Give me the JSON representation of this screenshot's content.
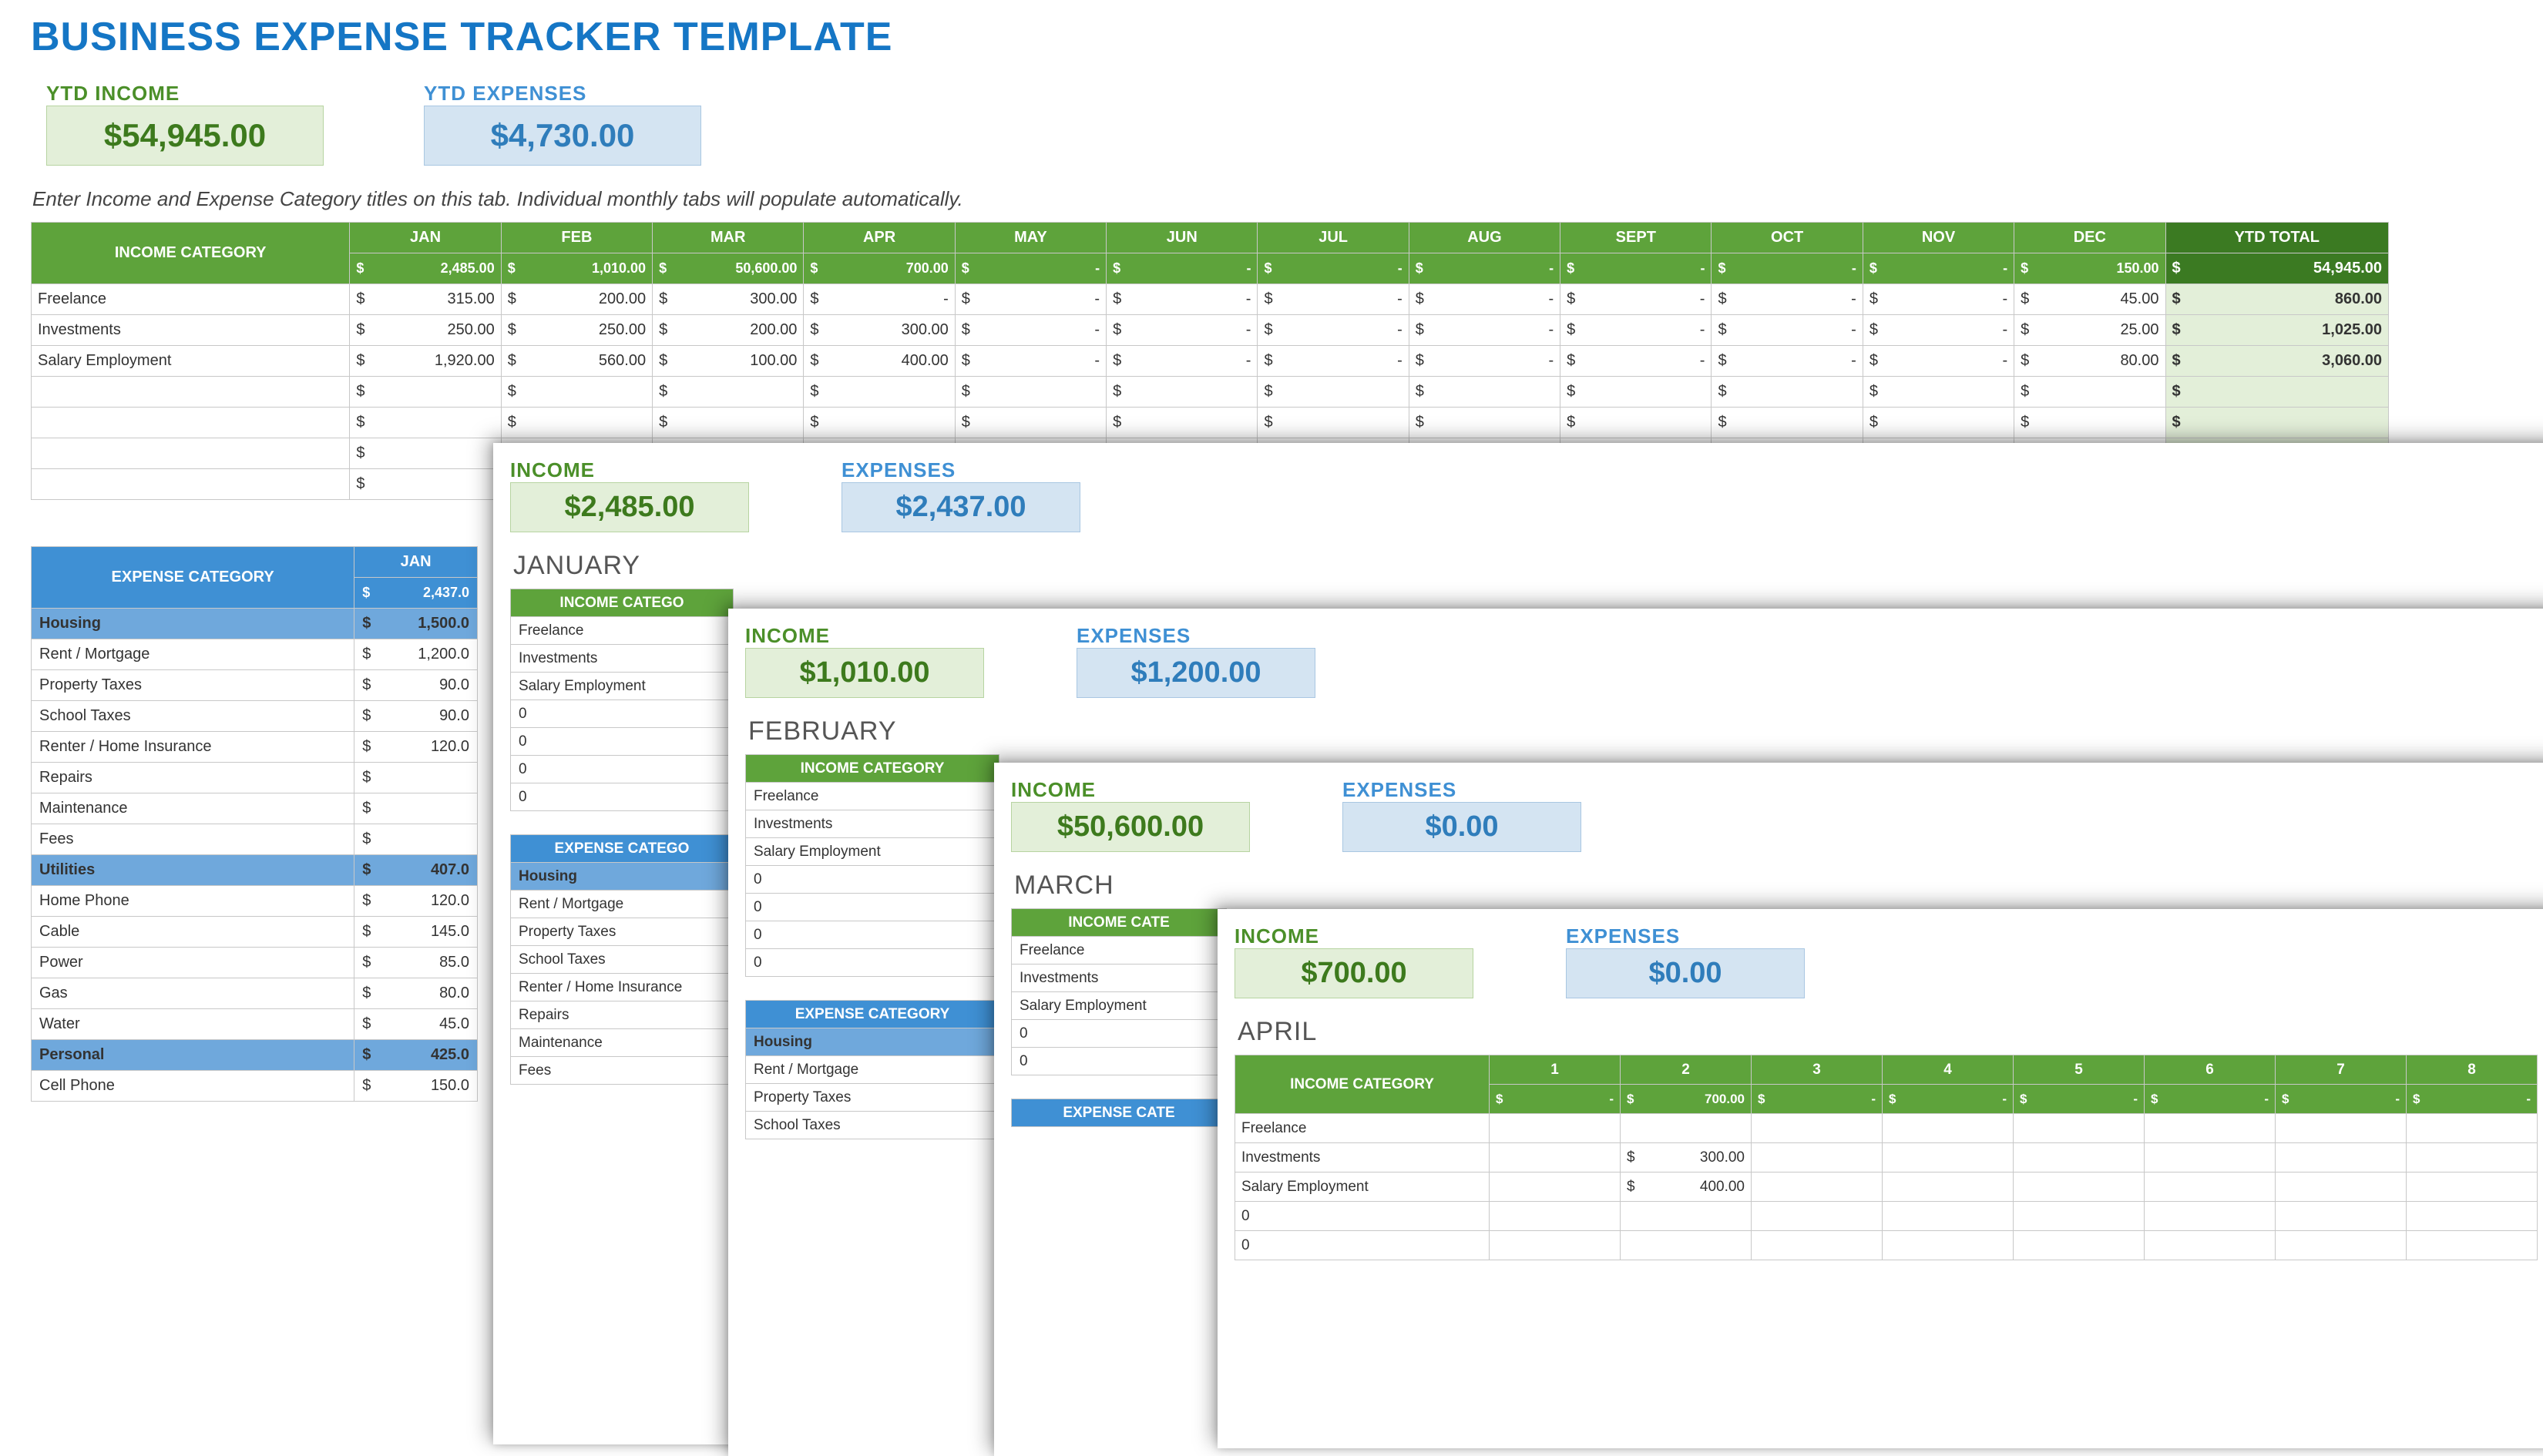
{
  "title": "BUSINESS EXPENSE TRACKER TEMPLATE",
  "ytd": {
    "income_label": "YTD INCOME",
    "income_value": "$54,945.00",
    "expenses_label": "YTD EXPENSES",
    "expenses_value": "$4,730.00"
  },
  "instruction": "Enter Income and Expense Category titles on this tab.  Individual monthly tabs will populate automatically.",
  "months": [
    "JAN",
    "FEB",
    "MAR",
    "APR",
    "MAY",
    "JUN",
    "JUL",
    "AUG",
    "SEPT",
    "OCT",
    "NOV",
    "DEC"
  ],
  "income_header": "INCOME CATEGORY",
  "ytd_total_header": "YTD TOTAL",
  "month_totals": [
    "2,485.00",
    "1,010.00",
    "50,600.00",
    "700.00",
    "-",
    "-",
    "-",
    "-",
    "-",
    "-",
    "-",
    "150.00"
  ],
  "ytd_total_value": "54,945.00",
  "income_rows": [
    {
      "name": "Freelance",
      "vals": [
        "315.00",
        "200.00",
        "300.00",
        "-",
        "-",
        "-",
        "-",
        "-",
        "-",
        "-",
        "-",
        "45.00"
      ],
      "ytd": "860.00"
    },
    {
      "name": "Investments",
      "vals": [
        "250.00",
        "250.00",
        "200.00",
        "300.00",
        "-",
        "-",
        "-",
        "-",
        "-",
        "-",
        "-",
        "25.00"
      ],
      "ytd": "1,025.00"
    },
    {
      "name": "Salary Employment",
      "vals": [
        "1,920.00",
        "560.00",
        "100.00",
        "400.00",
        "-",
        "-",
        "-",
        "-",
        "-",
        "-",
        "-",
        "80.00"
      ],
      "ytd": "3,060.00"
    },
    {
      "name": "",
      "vals": [
        "",
        "",
        "",
        "",
        "",
        "",
        "",
        "",
        "",
        "",
        "",
        ""
      ],
      "ytd": ""
    },
    {
      "name": "",
      "vals": [
        "",
        "",
        "",
        "",
        "",
        "",
        "",
        "",
        "",
        "",
        "",
        ""
      ],
      "ytd": ""
    },
    {
      "name": "",
      "vals": [
        "",
        "",
        "",
        "",
        "",
        "",
        "",
        "",
        "",
        "",
        "",
        ""
      ],
      "ytd": ""
    },
    {
      "name": "",
      "vals": [
        "",
        "",
        "",
        "",
        "",
        "",
        "",
        "",
        "",
        "",
        "",
        ""
      ],
      "ytd": ""
    }
  ],
  "expense_header": "EXPENSE CATEGORY",
  "exp_jan_total": "2,437.0",
  "expense_rows": [
    {
      "name": "Housing",
      "val": "1,500.0",
      "section": true
    },
    {
      "name": "Rent / Mortgage",
      "val": "1,200.0"
    },
    {
      "name": "Property Taxes",
      "val": "90.0"
    },
    {
      "name": "School Taxes",
      "val": "90.0"
    },
    {
      "name": "Renter / Home Insurance",
      "val": "120.0"
    },
    {
      "name": "Repairs",
      "val": ""
    },
    {
      "name": "Maintenance",
      "val": ""
    },
    {
      "name": "Fees",
      "val": ""
    },
    {
      "name": "Utilities",
      "val": "407.0",
      "section": true
    },
    {
      "name": "Home Phone",
      "val": "120.0"
    },
    {
      "name": "Cable",
      "val": "145.0"
    },
    {
      "name": "Power",
      "val": "85.0"
    },
    {
      "name": "Gas",
      "val": "80.0"
    },
    {
      "name": "Water",
      "val": "45.0"
    },
    {
      "name": "Personal",
      "val": "425.0",
      "section": true
    },
    {
      "name": "Cell Phone",
      "val": "150.0"
    }
  ],
  "panel_jan": {
    "income_label": "INCOME",
    "income_value": "$2,485.00",
    "exp_label": "EXPENSES",
    "exp_value": "$2,437.00",
    "month": "JANUARY",
    "inc_header": "INCOME CATEGO",
    "inc_rows": [
      "Freelance",
      "Investments",
      "Salary Employment",
      "0",
      "0",
      "0",
      "0"
    ],
    "exp_header": "EXPENSE CATEGO",
    "exp_rows": [
      "Housing",
      "Rent / Mortgage",
      "Property Taxes",
      "School Taxes",
      "Renter / Home Insurance",
      "Repairs",
      "Maintenance",
      "Fees"
    ]
  },
  "panel_feb": {
    "income_label": "INCOME",
    "income_value": "$1,010.00",
    "exp_label": "EXPENSES",
    "exp_value": "$1,200.00",
    "month": "FEBRUARY",
    "inc_header": "INCOME CATEGORY",
    "inc_rows": [
      "Freelance",
      "Investments",
      "Salary Employment",
      "0",
      "0",
      "0",
      "0"
    ],
    "exp_header": "EXPENSE CATEGORY",
    "exp_rows": [
      "Housing",
      "Rent / Mortgage",
      "Property Taxes",
      "School Taxes"
    ]
  },
  "panel_mar": {
    "income_label": "INCOME",
    "income_value": "$50,600.00",
    "exp_label": "EXPENSES",
    "exp_value": "$0.00",
    "month": "MARCH",
    "inc_header": "INCOME CATE",
    "inc_rows": [
      "Freelance",
      "Investments",
      "Salary Employment",
      "0",
      "0"
    ],
    "exp_header": "EXPENSE CATE"
  },
  "panel_apr": {
    "income_label": "INCOME",
    "income_value": "$700.00",
    "exp_label": "EXPENSES",
    "exp_value": "$0.00",
    "month": "APRIL",
    "inc_header": "INCOME CATEGORY",
    "days": [
      "1",
      "2",
      "3",
      "4",
      "5",
      "6",
      "7",
      "8"
    ],
    "day_totals": [
      "-",
      "700.00",
      "-",
      "-",
      "-",
      "-",
      "-",
      "-"
    ],
    "rows": [
      {
        "name": "Freelance",
        "vals": [
          "",
          "",
          "",
          "",
          "",
          "",
          "",
          ""
        ]
      },
      {
        "name": "Investments",
        "vals": [
          "",
          "300.00",
          "",
          "",
          "",
          "",
          "",
          ""
        ]
      },
      {
        "name": "Salary Employment",
        "vals": [
          "",
          "400.00",
          "",
          "",
          "",
          "",
          "",
          ""
        ]
      },
      {
        "name": "0",
        "vals": [
          "",
          "",
          "",
          "",
          "",
          "",
          "",
          ""
        ]
      },
      {
        "name": "0",
        "vals": [
          "",
          "",
          "",
          "",
          "",
          "",
          "",
          ""
        ]
      }
    ]
  },
  "currency": "$"
}
